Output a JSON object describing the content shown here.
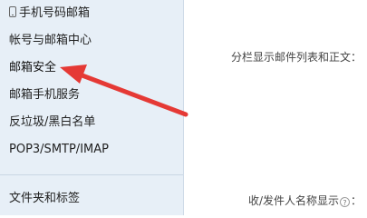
{
  "sidebar": {
    "items": [
      {
        "label": "手机号码邮箱",
        "icon": "phone-icon"
      },
      {
        "label": "帐号与邮箱中心"
      },
      {
        "label": "邮箱安全"
      },
      {
        "label": "邮箱手机服务"
      },
      {
        "label": "反垃圾/黑白名单"
      },
      {
        "label": "POP3/SMTP/IMAP"
      },
      {
        "label": "文件夹和标签"
      }
    ]
  },
  "main": {
    "split_view_label": "分栏显示邮件列表和正文：",
    "sender_name_label": "收/发件人名称显示",
    "sender_name_help": "?",
    "sender_name_colon": "："
  },
  "annotation": {
    "arrow_color": "#e53935",
    "points_to": "邮箱安全"
  }
}
